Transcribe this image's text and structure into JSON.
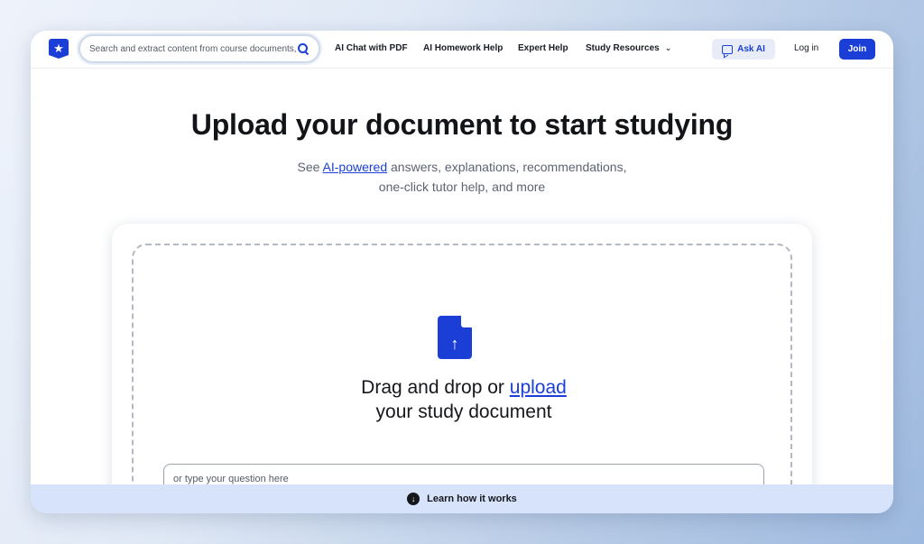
{
  "header": {
    "search_placeholder": "Search and extract content from course documents,",
    "nav": [
      "AI Chat with PDF",
      "AI Homework Help",
      "Expert Help",
      "Study Resources"
    ],
    "ask_ai": "Ask AI",
    "login": "Log in",
    "join": "Join"
  },
  "hero": {
    "title": "Upload your document to start studying",
    "subtitle_prefix": "See ",
    "subtitle_link": "AI-powered",
    "subtitle_suffix": " answers, explanations, recommendations,",
    "subtitle_line2": "one-click tutor help, and more"
  },
  "upload": {
    "line1_prefix": "Drag and drop or ",
    "line1_link": "upload",
    "line2": "your study document",
    "question_placeholder": "or type your question here"
  },
  "footer": {
    "learn": "Learn how it works"
  },
  "colors": {
    "brand": "#1b3fd6",
    "footer_bar": "#d7e2fb"
  }
}
